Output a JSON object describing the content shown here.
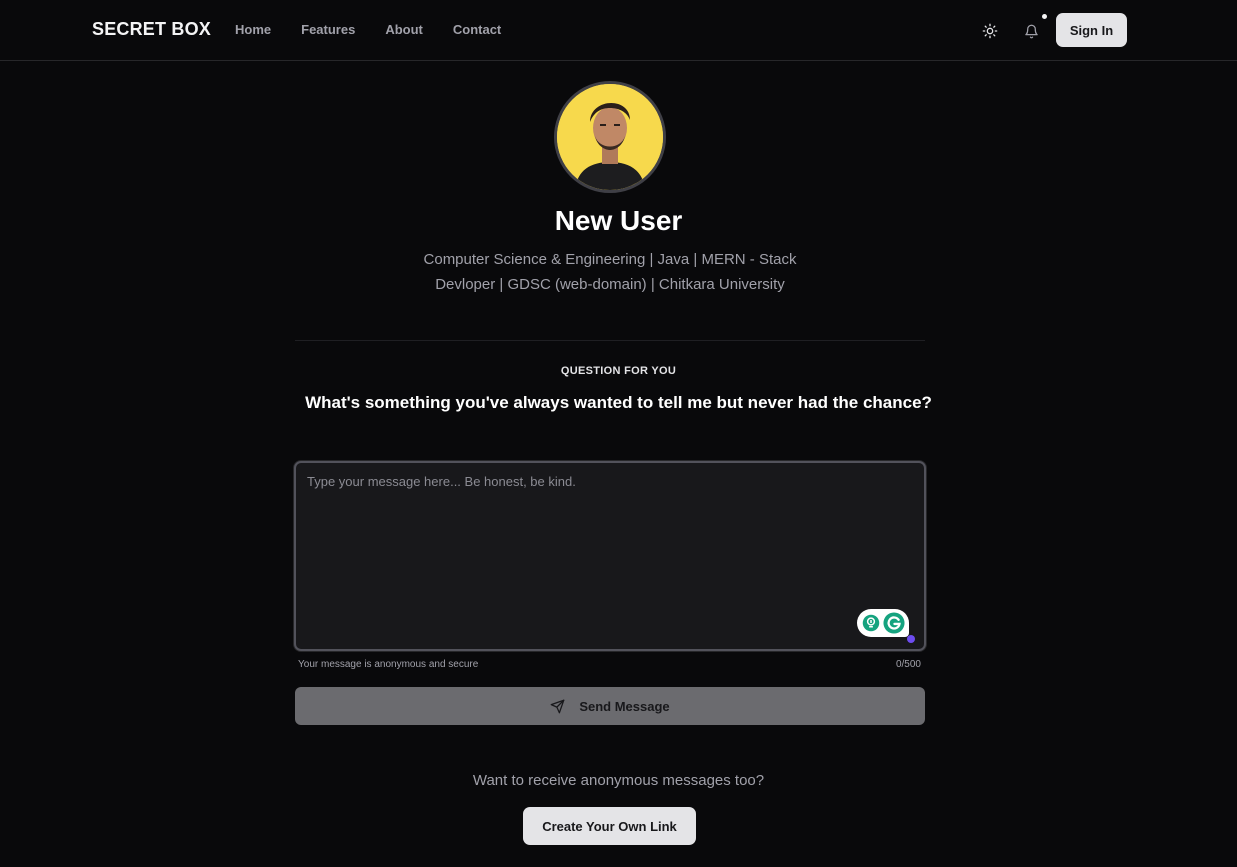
{
  "nav": {
    "brand": "SECRET BOX",
    "links": [
      "Home",
      "Features",
      "About",
      "Contact"
    ],
    "theme_icon": "sun-icon",
    "notification_icon": "bell-icon",
    "signin_label": "Sign In"
  },
  "profile": {
    "name": "New User",
    "bio_line1": "Computer Science & Engineering | Java | MERN - Stack",
    "bio_line2": "Devloper | GDSC (web-domain) | Chitkara University",
    "avatar_icon": "user-avatar"
  },
  "question": {
    "label": "QUESTION FOR YOU",
    "text": "What's something you've always wanted to tell me but never had the chance?"
  },
  "message": {
    "placeholder": "Type your message here... Be honest, be kind.",
    "value": "",
    "hint": "Your message is anonymous and secure",
    "counter": "0/500",
    "send_label": "Send Message",
    "send_icon": "send-icon"
  },
  "cta": {
    "text": "Want to receive anonymous messages too?",
    "button_label": "Create Your Own Link"
  },
  "colors": {
    "background": "#09090b",
    "avatar_bg": "#f7d94c",
    "button_light": "#e4e4e7",
    "send_disabled": "#6b6b6f",
    "grammarly_green": "#15a37f"
  }
}
